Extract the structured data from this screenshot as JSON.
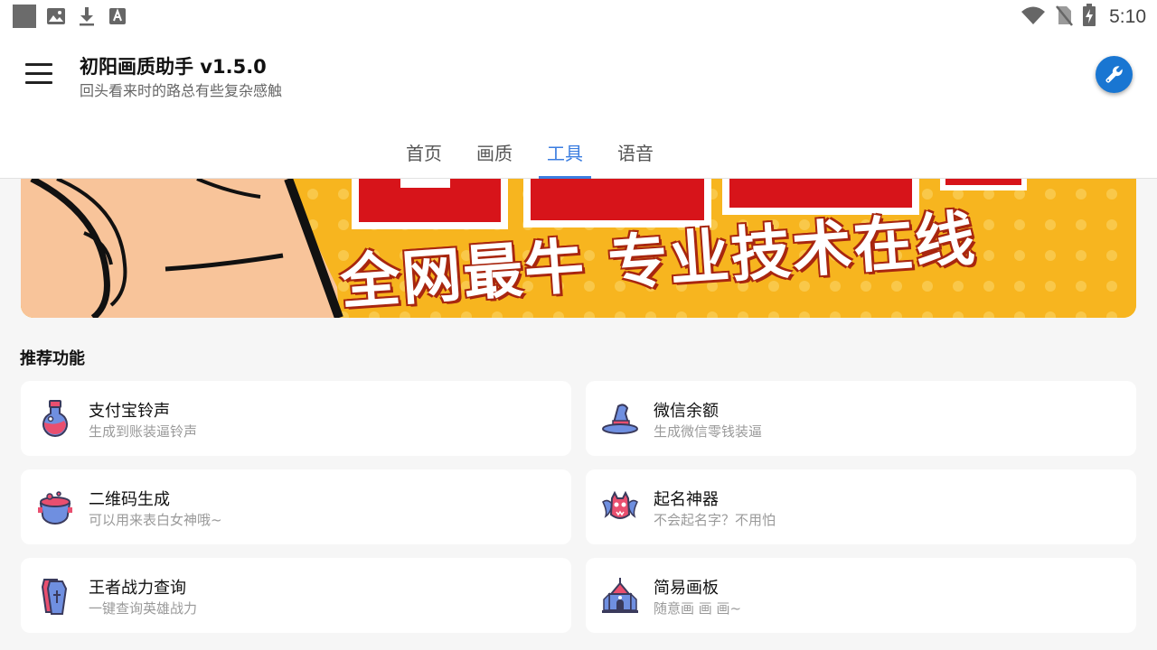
{
  "status_bar": {
    "left_icons": [
      "app-square-icon",
      "image-icon",
      "download-icon",
      "font-icon"
    ],
    "right_icons": [
      "wifi-icon",
      "no-sim-icon",
      "battery-charging-icon"
    ],
    "time": "5:10"
  },
  "header": {
    "title": "初阳画质助手 v1.5.0",
    "subtitle": "回头看来时的路总有些复杂感触",
    "menu_icon": "hamburger-menu-icon",
    "action_icon": "wrench-icon",
    "accent_color": "#1976d2"
  },
  "tabs": [
    {
      "label": "首页",
      "active": false
    },
    {
      "label": "画质",
      "active": false
    },
    {
      "label": "工具",
      "active": true
    },
    {
      "label": "语音",
      "active": false
    }
  ],
  "tab_active_color": "#3b7de0",
  "banner": {
    "text": "全网最牛 专业技术在线"
  },
  "section": {
    "title": "推荐功能"
  },
  "cards": [
    {
      "title": "支付宝铃声",
      "subtitle": "生成到账装逼铃声",
      "icon": "potion-flask-icon"
    },
    {
      "title": "微信余额",
      "subtitle": "生成微信零钱装逼",
      "icon": "wizard-hat-icon"
    },
    {
      "title": "二维码生成",
      "subtitle": "可以用来表白女神哦~",
      "icon": "cauldron-icon"
    },
    {
      "title": "起名神器",
      "subtitle": "不会起名字？不用怕",
      "icon": "bat-icon"
    },
    {
      "title": "王者战力查询",
      "subtitle": "一键查询英雄战力",
      "icon": "coffin-icon"
    },
    {
      "title": "简易画板",
      "subtitle": "随意画 画 画~",
      "icon": "haunted-house-icon"
    }
  ]
}
